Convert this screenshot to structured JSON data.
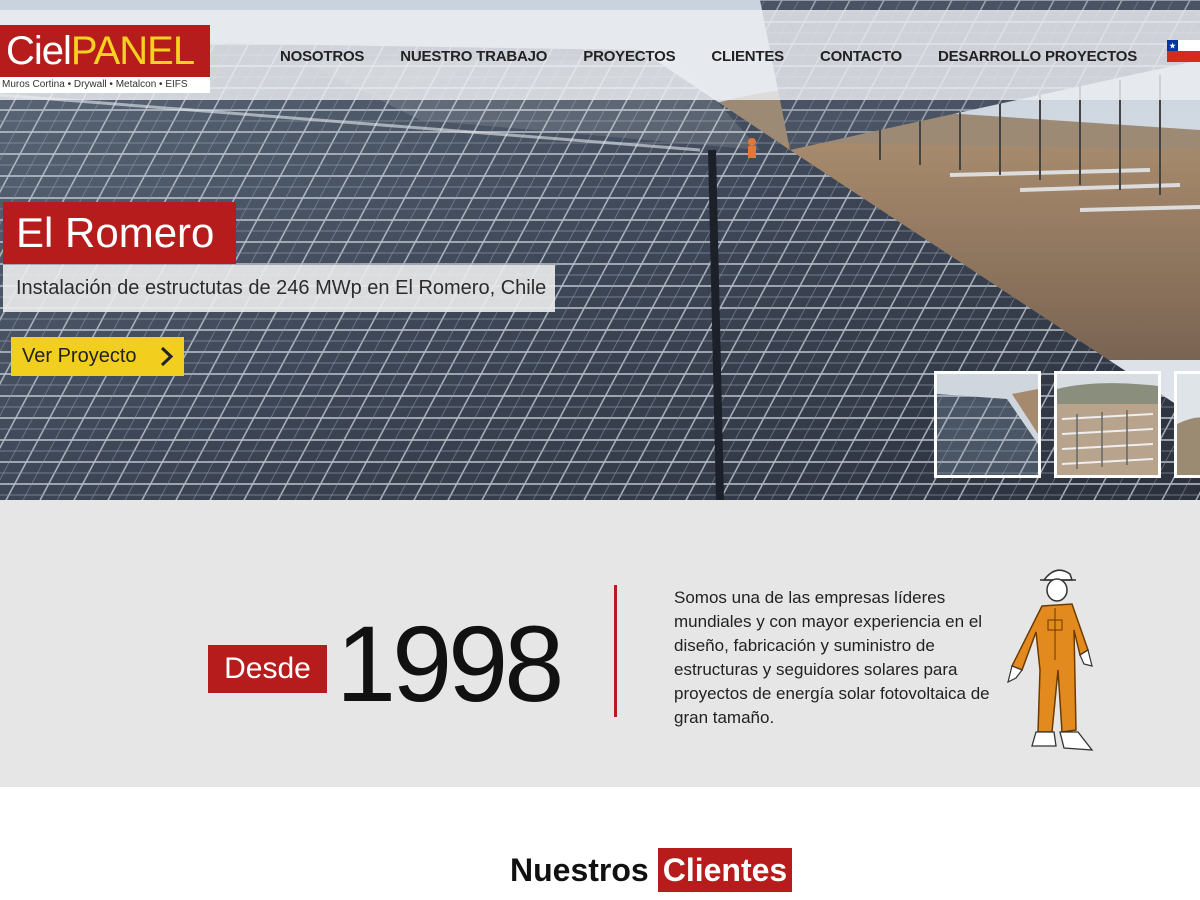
{
  "brand": {
    "logo_primary": "Ciel",
    "logo_secondary": "PANEL",
    "tagline": "Muros Cortina • Drywall • Metalcon • EIFS",
    "colors": {
      "red": "#b71c1c",
      "yellow": "#f2cf1f"
    }
  },
  "nav": {
    "items": [
      {
        "label": "NOSOTROS"
      },
      {
        "label": "NUESTRO TRABAJO"
      },
      {
        "label": "PROYECTOS"
      },
      {
        "label": "CLIENTES"
      },
      {
        "label": "CONTACTO"
      },
      {
        "label": "DESARROLLO PROYECTOS"
      }
    ],
    "language_flag": "chile-flag-icon"
  },
  "hero": {
    "title": "El Romero",
    "subtitle": "Instalación  de estructutas de 246 MWp en El Romero, Chile",
    "cta_label": "Ver Proyecto",
    "cta_icon": "chevron-right-icon",
    "thumbnails": [
      {
        "name": "solar-panels-thumbnail"
      },
      {
        "name": "structure-construction-thumbnail"
      },
      {
        "name": "landscape-thumbnail"
      }
    ]
  },
  "since": {
    "label": "Desde",
    "year": "1998",
    "description": "Somos una de las empresas líderes mundiales y con mayor experiencia en el diseño, fabricación y suministro de estructuras y seguidores solares para proyectos de energía solar fotovoltaica de gran tamaño.",
    "mascot": "worker-mascot-illustration"
  },
  "clients": {
    "heading_part1": "Nuestros",
    "heading_part2": "Clientes"
  }
}
